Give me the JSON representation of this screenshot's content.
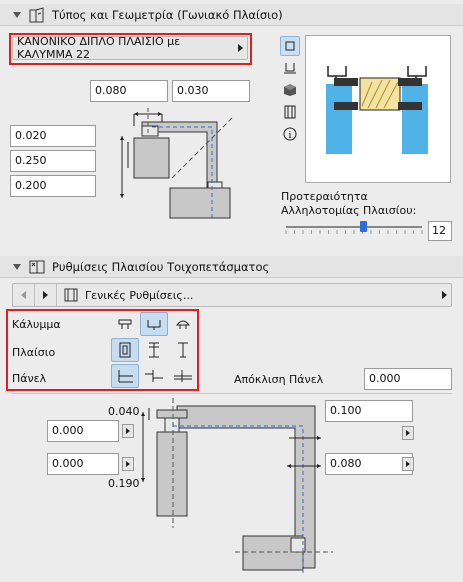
{
  "section1": {
    "title": "Τύπος και Γεωμετρία (Γωνιακό Πλαίσιο)"
  },
  "type_selector": {
    "value": "ΚΑΝΟΝΙΚΟ ΔΙΠΛΟ ΠΛΑΙΣΙΟ με ΚΑΛΥΜΜΑ 22"
  },
  "geometry": {
    "top_left": "0.080",
    "top_right": "0.030",
    "left_1": "0.020",
    "left_2": "0.250",
    "left_3": "0.200"
  },
  "priority": {
    "label_line1": "Προτεραιότητα",
    "label_line2": "Αλληλοτομίας Πλαισίου:",
    "value": "12",
    "slider_fraction": 0.57
  },
  "section2": {
    "title": "Ρυθμίσεις Πλαισίου Τοιχοπετάσματος"
  },
  "general_bar": {
    "label": "Γενικές Ρυθμίσεις..."
  },
  "options": {
    "cover_label": "Κάλυμμα",
    "frame_label": "Πλαίσιο",
    "panel_label": "Πάνελ"
  },
  "panel_offset": {
    "label": "Απόκλιση Πάνελ",
    "value": "0.000"
  },
  "bottom": {
    "dim_top": "0.040",
    "dim_bottom": "0.190",
    "field_left_1": "0.000",
    "field_left_2": "0.000",
    "field_right_1": "0.100",
    "field_right_2": "0.080"
  },
  "colors": {
    "accent": "#c9dff2",
    "highlight": "#e02020",
    "fill": "#c8c8c8",
    "dash": "#2d6fd6"
  }
}
